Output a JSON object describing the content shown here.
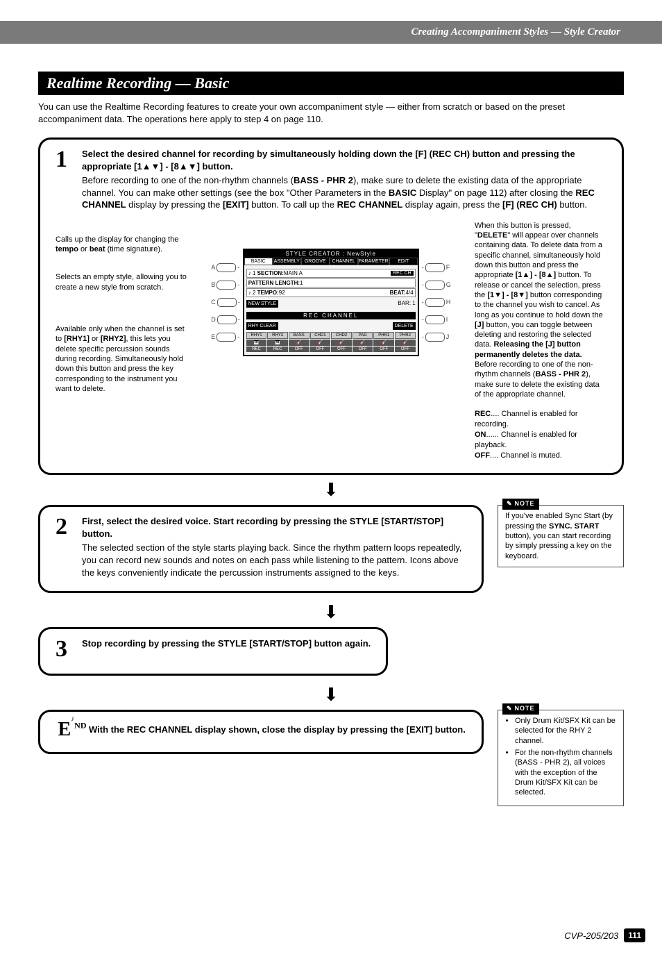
{
  "header": {
    "breadcrumb": "Creating Accompaniment Styles — Style Creator"
  },
  "title": "Realtime Recording — Basic",
  "intro": "You can use the Realtime Recording features to create your own accompaniment style — either from scratch or based on the preset accompaniment data. The operations here apply to step 4 on page 110.",
  "step1": {
    "num": "1",
    "title_a": "Select the desired channel for recording by simultaneously holding down the [F] (REC CH) button and pressing the appropriate [1▲▼] - [8▲▼] button.",
    "body_a": "Before recording to one of the non-rhythm channels (",
    "body_bold": "BASS - PHR 2",
    "body_b": "), make sure to delete the existing data of the appropriate channel. You can make other settings (see the box \"Other Parameters in the ",
    "body_bold2": "BASIC",
    "body_c": " Display\" on page 112) after closing the ",
    "body_bold3": "REC CHANNEL",
    "body_d": " display by pressing the ",
    "body_bold4": "[EXIT]",
    "body_e": " button. To call up the ",
    "body_bold5": "REC CHANNEL",
    "body_f": " display again, press the ",
    "body_bold6": "[F] (REC CH)",
    "body_g": " button."
  },
  "callouts": {
    "tempo_a": "Calls up the display for changing the ",
    "tempo_b1": "tempo",
    "tempo_or": " or ",
    "tempo_b2": "beat",
    "tempo_c": " (time signature).",
    "newstyle": "Selects an empty style, allowing you to create a new style from scratch.",
    "rhyclear_a": "Available only when the channel is set to ",
    "rhyclear_b1": "[RHY1]",
    "rhyclear_or": " or ",
    "rhyclear_b2": "[RHY2]",
    "rhyclear_c": ", this lets you delete specific percussion sounds during recording. Simultaneously hold down this button and press the key corresponding to the instrument you want to delete.",
    "delete_a": "When this button is pressed, \"",
    "delete_b": "DELETE",
    "delete_c": "\" will appear over channels containing data.  To delete data from a specific channel, simultaneously hold down this button and press the appropriate ",
    "delete_d": "[1▲] - [8▲]",
    "delete_e": " button.  To release or cancel the selection, press the ",
    "delete_f": "[1▼] - [8▼]",
    "delete_g": " button corresponding to the channel you wish to cancel. As long as you continue to hold down the ",
    "delete_h": "[J]",
    "delete_i": " button, you can toggle between deleting and restoring the selected data. ",
    "delete_j": "Releasing the [J] button permanently deletes the data.",
    "delete_k": " Before recording to one of the non-rhythm channels (",
    "delete_l": "BASS - PHR 2",
    "delete_m": "), make sure to delete the existing data of the appropriate channel.",
    "leg_rec": "REC",
    "leg_rec_t": ".... Channel is enabled for recording.",
    "leg_on": "ON",
    "leg_on_t": "...... Channel is enabled for playback.",
    "leg_off": "OFF",
    "leg_off_t": ".... Channel is muted."
  },
  "lcd": {
    "title": "STYLE CREATOR : NewStyle",
    "tabs": [
      "BASIC",
      "ASSEMBLY",
      "GROOVE",
      "CHANNEL",
      "PARAMETER",
      "EDIT"
    ],
    "section_lbl": "SECTION:",
    "section_val": "MAIN A",
    "recch": "REC CH",
    "pattern_lbl": "PATTERN LENGTH:",
    "pattern_val": "1",
    "tempo_lbl": "TEMPO:",
    "tempo_val": "92",
    "beat_lbl": "BEAT:",
    "beat_val": "4/4",
    "newstyle": "NEW STYLE",
    "bar_lbl": "BAR:",
    "bar_val": "1",
    "strip": "REC CHANNEL",
    "rhyclear": "RHY CLEAR",
    "delete": "DELETE",
    "chans": [
      "RHY1",
      "RHY2",
      "BASS",
      "CHD1",
      "CHD2",
      "PAD",
      "PHR1",
      "PHR2"
    ],
    "ind1": [
      "REC",
      "REC",
      "OFF",
      "OFF",
      "OFF",
      "OFF",
      "OFF",
      "OFF"
    ]
  },
  "panel": {
    "left": [
      "A",
      "B",
      "C",
      "D",
      "E"
    ],
    "right": [
      "F",
      "G",
      "H",
      "I",
      "J"
    ]
  },
  "step2": {
    "num": "2",
    "title": "First, select the desired voice. Start recording by pressing the STYLE [START/STOP] button.",
    "body": "The selected section of the style starts playing back. Since the rhythm pattern loops repeatedly, you can record new sounds and notes on each pass while listening to the pattern. Icons above the keys conveniently indicate the percussion instruments assigned to the keys."
  },
  "note1": {
    "label": "NOTE",
    "a": "If you've enabled Sync Start (by pressing the ",
    "b": "SYNC. START",
    "c": " button), you can start recording by simply pressing a key on the keyboard."
  },
  "step3": {
    "num": "3",
    "title": "Stop recording by pressing the STYLE [START/STOP] button again."
  },
  "end": {
    "mark": "E",
    "sub": "ND",
    "title": "With the REC CHANNEL display shown, close the display by pressing the [EXIT] button."
  },
  "note2": {
    "label": "NOTE",
    "li1": "Only Drum Kit/SFX Kit can be selected for the RHY 2 channel.",
    "li2": "For the non-rhythm channels (BASS - PHR 2), all voices with the exception of the Drum Kit/SFX Kit can be selected."
  },
  "footer": {
    "model": "CVP-205/203",
    "page": "111"
  }
}
